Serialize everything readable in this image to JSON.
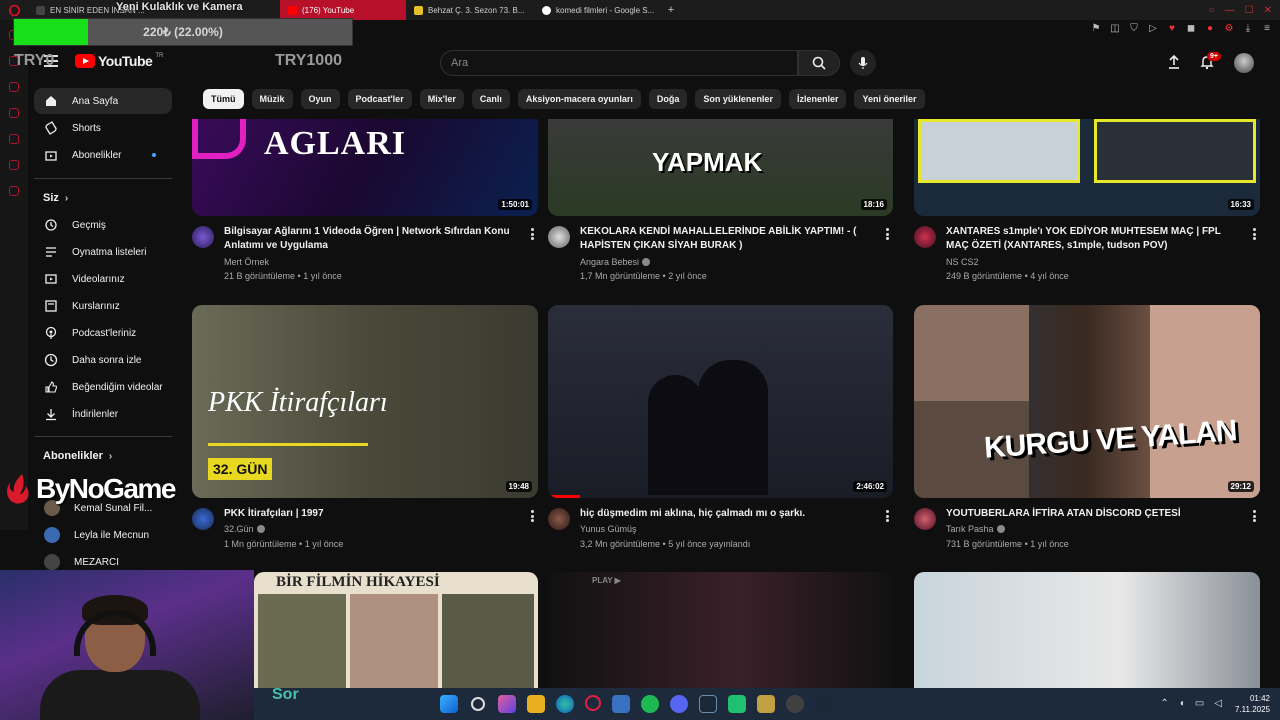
{
  "browser": {
    "tabs": [
      {
        "label": "EN SİNİR EDEN İNSAN ...",
        "active": false,
        "color": "#444444"
      },
      {
        "label": "(176) YouTube",
        "active": true,
        "color": "#ff0000"
      },
      {
        "label": "Behzat Ç. 3. Sezon 73. B...",
        "active": false,
        "color": "#e8c02a"
      },
      {
        "label": "komedi filmleri - Google S...",
        "active": false,
        "color": "#4285f4"
      }
    ],
    "new_tab": "+"
  },
  "overlay": {
    "title": "Yeni Kulaklık ve Kamera",
    "donation_text": "220₺ (22.00%)",
    "donation_percent": 22,
    "try_left": "TRY0",
    "try_right": "TRY1000",
    "sponsor": "ByNoGame",
    "sor": "Sor"
  },
  "header": {
    "logo_text": "YouTube",
    "logo_country": "TR",
    "search_placeholder": "Ara",
    "notif_count": "9+"
  },
  "sidebar": {
    "main": [
      {
        "label": "Ana Sayfa",
        "icon": "home-icon",
        "active": true
      },
      {
        "label": "Shorts",
        "icon": "shorts-icon",
        "active": false
      },
      {
        "label": "Abonelikler",
        "icon": "subscriptions-icon",
        "active": false
      }
    ],
    "you_heading": "Siz",
    "you_items": [
      {
        "label": "Geçmiş",
        "icon": "history-icon"
      },
      {
        "label": "Oynatma listeleri",
        "icon": "playlists-icon"
      },
      {
        "label": "Videolarınız",
        "icon": "your-videos-icon"
      },
      {
        "label": "Kurslarınız",
        "icon": "courses-icon"
      },
      {
        "label": "Podcast'leriniz",
        "icon": "podcasts-icon"
      },
      {
        "label": "Daha sonra izle",
        "icon": "watch-later-icon"
      },
      {
        "label": "Beğendiğim videolar",
        "icon": "liked-icon"
      },
      {
        "label": "İndirilenler",
        "icon": "downloads-icon"
      }
    ],
    "subs_heading": "Abonelikler",
    "subs": [
      {
        "label": "Kemal Sunal Fil...",
        "color": "#6a5a4a"
      },
      {
        "label": "Leyla ile Mecnun",
        "color": "#3a6ab0"
      },
      {
        "label": "MEZARCI",
        "color": "#444444"
      }
    ]
  },
  "chips": [
    "Tümü",
    "Müzik",
    "Oyun",
    "Podcast'ler",
    "Mix'ler",
    "Canlı",
    "Aksiyon-macera oyunları",
    "Doğa",
    "Son yüklenenler",
    "İzlenenler",
    "Yeni öneriler"
  ],
  "videos_row1": [
    {
      "title": "Bilgisayar Ağlarını 1 Videoda Öğren | Network Sıfırdan Konu Anlatımı ve Uygulama",
      "channel": "Mert Örnek",
      "views": "21 B görüntüleme",
      "age": "1 yıl önce",
      "duration": "1:50:01",
      "thumb_text": "AGLARI",
      "verified": false
    },
    {
      "title": "KEKOLARA KENDİ MAHALLELERİNDE ABİLİK YAPTIM! - ( HAPİSTEN ÇIKAN SİYAH BURAK )",
      "channel": "Angara Bebesi",
      "views": "1,7 Mn görüntüleme",
      "age": "2 yıl önce",
      "duration": "18:16",
      "thumb_text": "YAPMAK",
      "verified": true
    },
    {
      "title": "XANTARES s1mple'ı YOK EDİYOR MUHTESEM MAÇ | FPL MAÇ ÖZETİ (XANTARES, s1mple, tudson POV)",
      "channel": "NS CS2",
      "views": "249 B görüntüleme",
      "age": "4 yıl önce",
      "duration": "16:33",
      "thumb_text": "",
      "verified": false
    }
  ],
  "videos_row2": [
    {
      "title": "PKK İtirafçıları | 1997",
      "channel": "32.Gün",
      "views": "1 Mn görüntüleme",
      "age": "1 yıl önce",
      "duration": "19:48",
      "thumb_text": "PKK İtirafçıları",
      "thumb_badge": "32. GÜN",
      "verified": true
    },
    {
      "title": "hiç düşmedim mi aklına, hiç çalmadı mı o şarkı.",
      "channel": "Yunus Gümüş",
      "views": "3,2 Mn görüntüleme",
      "age": "5 yıl önce yayınlandı",
      "duration": "2:46:02",
      "thumb_text": "",
      "verified": false
    },
    {
      "title": "YOUTUBERLARA İFTİRA ATAN DİSCORD ÇETESİ",
      "channel": "Tarık Pasha",
      "views": "731 B görüntüleme",
      "age": "1 yıl önce",
      "duration": "29:12",
      "thumb_text": "KURGU VE YALAN",
      "verified": true
    }
  ],
  "row3": {
    "thumb1_text": "BİR FİLMİN HİKAYESİ",
    "thumb2_text": "PLAY ▶"
  },
  "taskbar": {
    "time": "01:42",
    "date": "7.11.2025"
  },
  "colors": {
    "accent": "#ff0000",
    "bg": "#0f0f0f",
    "chip": "#272727",
    "donation": "#17e01b",
    "opera": "#b8102a"
  }
}
